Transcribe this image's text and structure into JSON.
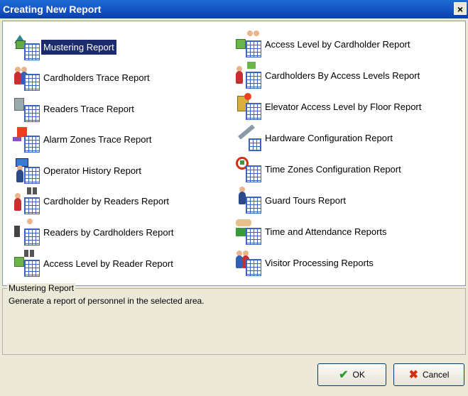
{
  "window": {
    "title": "Creating New Report",
    "close_glyph": "×"
  },
  "reports_left": [
    {
      "label": "Mustering Report",
      "icon": "mustering-report-icon",
      "selected": true
    },
    {
      "label": "Cardholders Trace Report",
      "icon": "cardholders-trace-icon"
    },
    {
      "label": "Readers Trace Report",
      "icon": "readers-trace-icon"
    },
    {
      "label": "Alarm Zones Trace Report",
      "icon": "alarm-zones-trace-icon"
    },
    {
      "label": "Operator History Report",
      "icon": "operator-history-icon"
    },
    {
      "label": "Cardholder by Readers Report",
      "icon": "cardholder-by-readers-icon"
    },
    {
      "label": "Readers by Cardholders Report",
      "icon": "readers-by-cardholders-icon"
    },
    {
      "label": "Access Level by Reader Report",
      "icon": "access-level-by-reader-icon"
    }
  ],
  "reports_right": [
    {
      "label": "Access Level by Cardholder Report",
      "icon": "access-level-by-cardholder-icon"
    },
    {
      "label": "Cardholders By Access Levels Report",
      "icon": "cardholders-by-access-levels-icon"
    },
    {
      "label": "Elevator Access Level by Floor Report",
      "icon": "elevator-access-level-icon"
    },
    {
      "label": "Hardware Configuration Report",
      "icon": "hardware-configuration-icon"
    },
    {
      "label": "Time Zones Configuration Report",
      "icon": "time-zones-configuration-icon"
    },
    {
      "label": "Guard Tours Report",
      "icon": "guard-tours-icon"
    },
    {
      "label": "Time and Attendance Reports",
      "icon": "time-and-attendance-icon"
    },
    {
      "label": "Visitor Processing Reports",
      "icon": "visitor-processing-icon"
    }
  ],
  "details": {
    "title": "Mustering Report",
    "description": "Generate a report of personnel in the selected area."
  },
  "buttons": {
    "ok": "OK",
    "cancel": "Cancel"
  },
  "colors": {
    "titlebar": "#0a3fb0",
    "selection": "#1b2b6e",
    "ok_check": "#2e9a2e",
    "cancel_x": "#d03010"
  }
}
